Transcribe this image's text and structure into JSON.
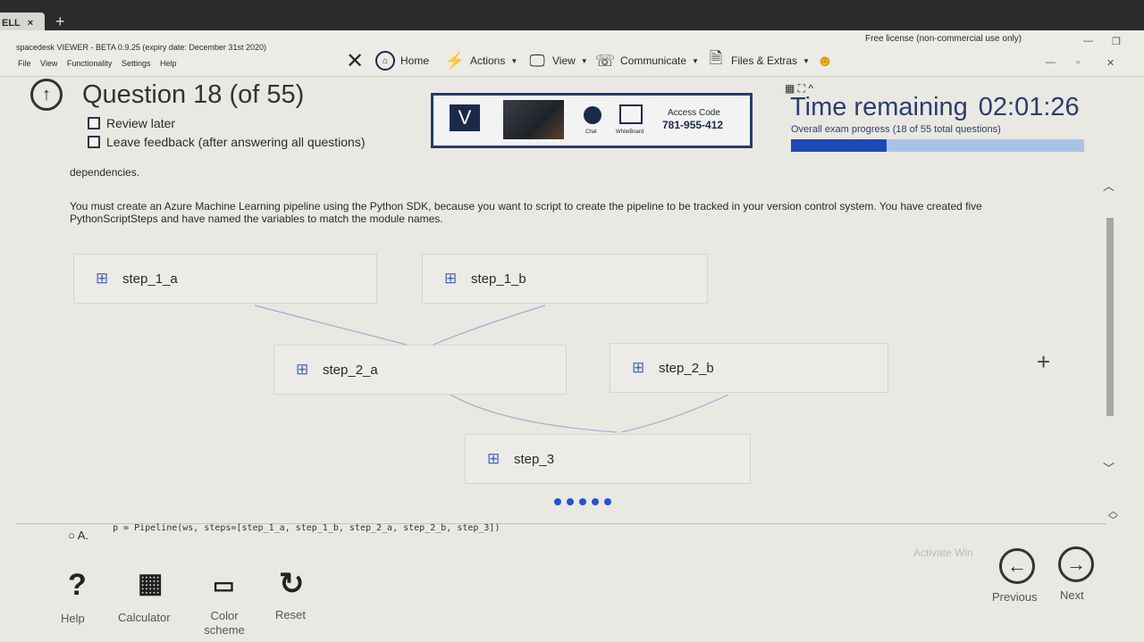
{
  "browser": {
    "tab_label": "ELL",
    "tab_close": "×",
    "new_tab": "+"
  },
  "app": {
    "title": "spacedesk VIEWER - BETA 0.9.25 (expiry date: December 31st 2020)",
    "menu": [
      "File",
      "View",
      "Functionality",
      "Settings",
      "Help"
    ],
    "license": "Free license (non-commercial use only)"
  },
  "toolbar": {
    "home": "Home",
    "actions": "Actions",
    "view": "View",
    "communicate": "Communicate",
    "files": "Files & Extras"
  },
  "remote": {
    "chat": "Chat",
    "whiteboard": "WhiteBoard",
    "access_label": "Access Code",
    "access_code": "781-955-412"
  },
  "exam": {
    "question_title": "Question 18 (of 55)",
    "review_later": "Review later",
    "leave_feedback": "Leave feedback (after answering all questions)",
    "time_label": "Time remaining",
    "time_value": "02:01:26",
    "progress_text": "Overall exam progress (18 of 55 total questions)",
    "progress_fraction": 0.327
  },
  "question": {
    "dependencies": "dependencies.",
    "paragraph": "You must create an Azure Machine Learning pipeline using the Python SDK, because you want to script to create the pipeline to be tracked in your version control system. You have created five PythonScriptSteps and have named the variables to match the module names.",
    "steps": [
      "step_1_a",
      "step_1_b",
      "step_2_a",
      "step_2_b",
      "step_3"
    ],
    "option_letter": "A.",
    "option_code": "p = Pipeline(ws, steps=[step_1_a, step_1_b, step_2_a, step_2_b, step_3])",
    "zoom_plus": "+"
  },
  "bottom": {
    "help": "Help",
    "calculator": "Calculator",
    "color_scheme_1": "Color",
    "color_scheme_2": "scheme",
    "reset": "Reset",
    "previous": "Previous",
    "next": "Next",
    "watermark": "Activate Win"
  },
  "colors": {
    "accent": "#1d49b8",
    "progress_bg": "#a9c3e6",
    "title": "#2d3d6e"
  }
}
